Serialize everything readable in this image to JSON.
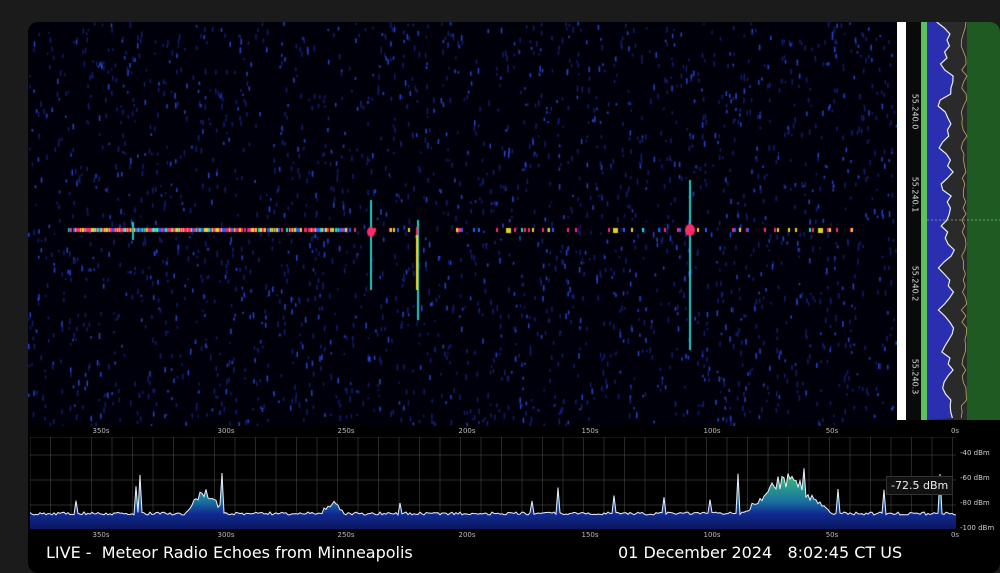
{
  "caption": "LIVE -  Meteor Radio Echoes from Minneapolis",
  "date": "01 December 2024",
  "time": "8:02:45 CT US",
  "frequency_labels": [
    "55.240.0",
    "55.240.1",
    "55.240.2",
    "55.240.3"
  ],
  "time_ticks": [
    "350s",
    "300s",
    "250s",
    "200s",
    "150s",
    "100s",
    "50s",
    "0s"
  ],
  "db_ticks": [
    "-40 dBm",
    "-60 dBm",
    "-80 dBm",
    "-100 dBm"
  ],
  "readout": "-72.5 dBm",
  "colors": {
    "background": "#000000",
    "noise": "#1a2a9a",
    "accent": "#2e9b3a"
  }
}
